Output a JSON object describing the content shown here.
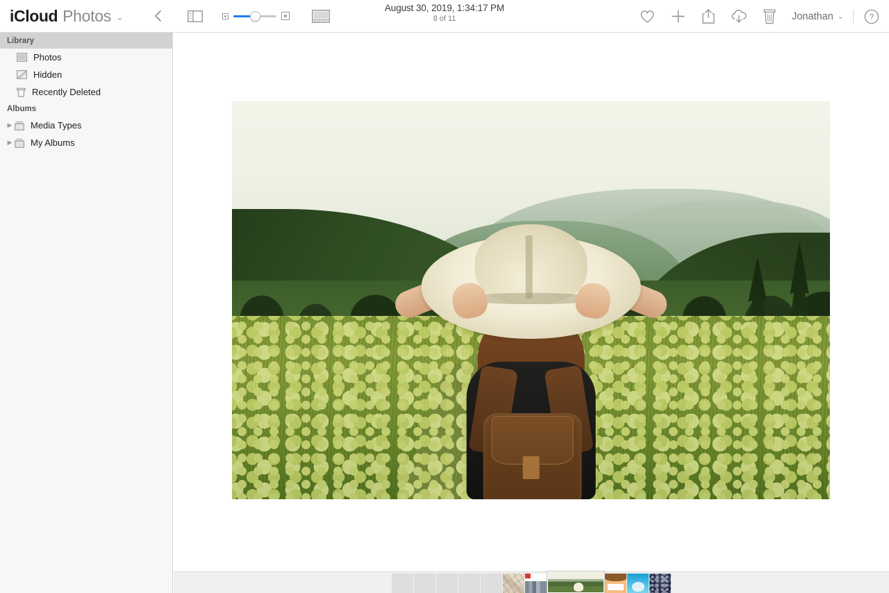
{
  "toolbar": {
    "brand_primary": "iCloud",
    "brand_app": "Photos",
    "brand_chevron": "⌄",
    "back_label": "Back",
    "sidebar_toggle_label": "Toggle Sidebar",
    "zoom": {
      "small_icon": "small-photo-icon",
      "large_icon": "large-photo-icon",
      "value_percent": 45
    },
    "view_button_label": "View Options",
    "title_date": "August 30, 2019, 1:34:17 PM",
    "title_count": "8 of 11",
    "actions": [
      {
        "name": "favorite",
        "icon": "heart-icon",
        "label": "Favorite"
      },
      {
        "name": "add",
        "icon": "plus-icon",
        "label": "Add To"
      },
      {
        "name": "share",
        "icon": "share-icon",
        "label": "Share"
      },
      {
        "name": "download",
        "icon": "cloud-download-icon",
        "label": "Download"
      },
      {
        "name": "delete",
        "icon": "trash-icon",
        "label": "Delete"
      }
    ],
    "account_name": "Jonathan",
    "account_chevron": "⌄",
    "help_label": "?"
  },
  "sidebar": {
    "sections": [
      {
        "title": "Library",
        "selected": true,
        "items": [
          {
            "label": "Photos",
            "icon": "photos-icon",
            "disclosure": false
          },
          {
            "label": "Hidden",
            "icon": "hidden-icon",
            "disclosure": false
          },
          {
            "label": "Recently Deleted",
            "icon": "trash-icon",
            "disclosure": false
          }
        ]
      },
      {
        "title": "Albums",
        "selected": false,
        "items": [
          {
            "label": "Media Types",
            "icon": "album-icon",
            "disclosure": true
          },
          {
            "label": "My Albums",
            "icon": "album-icon",
            "disclosure": true
          }
        ]
      }
    ],
    "disclosure_glyph": "▶"
  },
  "viewer": {
    "photo_alt": "Woman from behind holding wide-brim cream hat in a green mountain meadow",
    "photo_index": 8,
    "photo_total": 11
  },
  "filmstrip": {
    "thumbnails": [
      {
        "kind": "placeholder",
        "selected": false
      },
      {
        "kind": "placeholder",
        "selected": false
      },
      {
        "kind": "placeholder",
        "selected": false
      },
      {
        "kind": "placeholder",
        "selected": false
      },
      {
        "kind": "placeholder",
        "selected": false
      },
      {
        "kind": "map",
        "selected": false
      },
      {
        "kind": "web",
        "selected": false
      },
      {
        "kind": "landscape",
        "selected": true
      },
      {
        "kind": "emoji",
        "selected": false
      },
      {
        "kind": "cloud",
        "selected": false
      },
      {
        "kind": "night",
        "selected": false
      }
    ]
  },
  "colors": {
    "accent": "#1a7ef0",
    "toolbar_bg": "#ffffff",
    "sidebar_bg": "#f7f7f7",
    "sidebar_selected": "#d2d2d2",
    "filmstrip_bg": "#f0f0f0",
    "text_primary": "#1d1d1f",
    "text_secondary": "#6e6e73"
  }
}
